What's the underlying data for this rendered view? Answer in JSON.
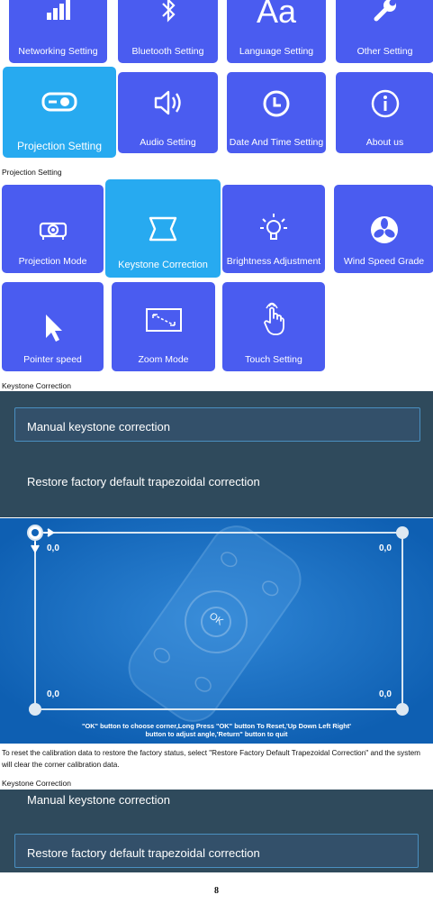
{
  "settings_row1": [
    {
      "label": "Networking Setting",
      "icon": "signal-bars-icon"
    },
    {
      "label": "Bluetooth Setting",
      "icon": "bluetooth-icon"
    },
    {
      "label": "Language Setting",
      "icon": "aa-text-icon"
    },
    {
      "label": "Other Setting",
      "icon": "wrench-icon"
    }
  ],
  "settings_row2": [
    {
      "label": "Projection Setting",
      "icon": "projector-icon",
      "selected": true
    },
    {
      "label": "Audio Setting",
      "icon": "speaker-icon"
    },
    {
      "label": "Date And Time Setting",
      "icon": "clock-icon"
    },
    {
      "label": "About us",
      "icon": "info-icon"
    }
  ],
  "caption1": "Projection Setting",
  "projection_row1": [
    {
      "label": "Projection Mode",
      "icon": "projector-icon"
    },
    {
      "label": "Keystone Correction",
      "icon": "keystone-icon",
      "selected": true
    },
    {
      "label": "Brightness Adjustment",
      "icon": "bulb-icon"
    },
    {
      "label": "Wind Speed Grade",
      "icon": "fan-icon"
    }
  ],
  "projection_row2": [
    {
      "label": "Pointer speed",
      "icon": "pointer-icon"
    },
    {
      "label": "Zoom Mode",
      "icon": "zoom-icon"
    },
    {
      "label": "Touch Setting",
      "icon": "touch-icon"
    }
  ],
  "caption2": "Keystone Correction",
  "keystone_menu": {
    "manual": "Manual keystone correction",
    "restore": "Restore factory default trapezoidal correction"
  },
  "calibration": {
    "top_left": "0,0",
    "top_right": "0,0",
    "bottom_left": "0,0",
    "bottom_right": "0,0",
    "ok_label": "OK",
    "instructions_line1": "\"OK\" button to choose corner,Long Press \"OK\" button To Reset,'Up Down Left Right'",
    "instructions_line2": "button to adjust angle,'Return\" button to quit"
  },
  "body_text": "To reset the calibration data to restore the factory status, select \"Restore Factory Default Trapezoidal Correction\" and the system will clear the corner calibration data.",
  "caption3": "Keystone Correction",
  "keystone_menu2": {
    "manual": "Manual keystone correction",
    "restore": "Restore factory default trapezoidal correction"
  },
  "page_number": "8",
  "colors": {
    "tile": "#4a5cf0",
    "tile_selected": "#27aaf0",
    "panel": "#2f4a5c",
    "calibration_bg": "#0e63b8"
  }
}
